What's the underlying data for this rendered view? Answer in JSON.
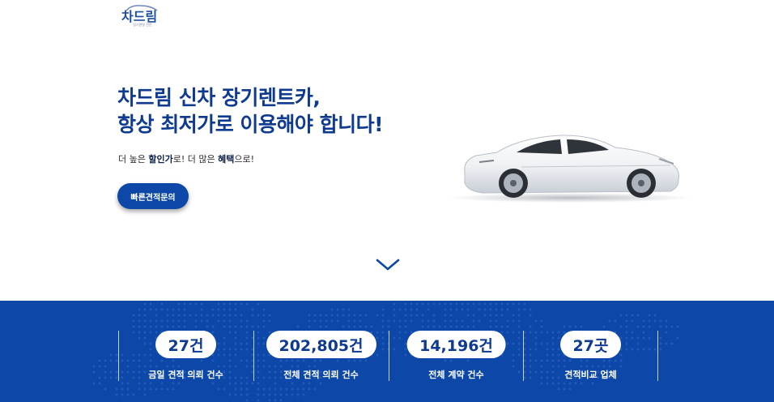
{
  "brand": {
    "logo_text": "차드림",
    "logo_tagline": "장기렌탈 전문"
  },
  "hero": {
    "title_line1": "차드림 신차 장기렌트카,",
    "title_line2": "항상 최저가로 이용해야 합니다!",
    "subtitle_parts": [
      "더 높은 ",
      "할인가",
      "로! 더 많은 ",
      "혜택",
      "으로!"
    ],
    "cta_label": "빠른견적문의"
  },
  "icons": {
    "scroll": "chevron-down-icon",
    "car": "white-sedan-image"
  },
  "colors": {
    "primary": "#0d48a8",
    "title": "#0e3a8f",
    "white": "#ffffff"
  },
  "stats": [
    {
      "value": "27건",
      "label": "금일 견적 의뢰 건수"
    },
    {
      "value": "202,805건",
      "label": "전체 견적 의뢰 건수"
    },
    {
      "value": "14,196건",
      "label": "전체 계약 건수"
    },
    {
      "value": "27곳",
      "label": "견적비교 업체"
    }
  ]
}
